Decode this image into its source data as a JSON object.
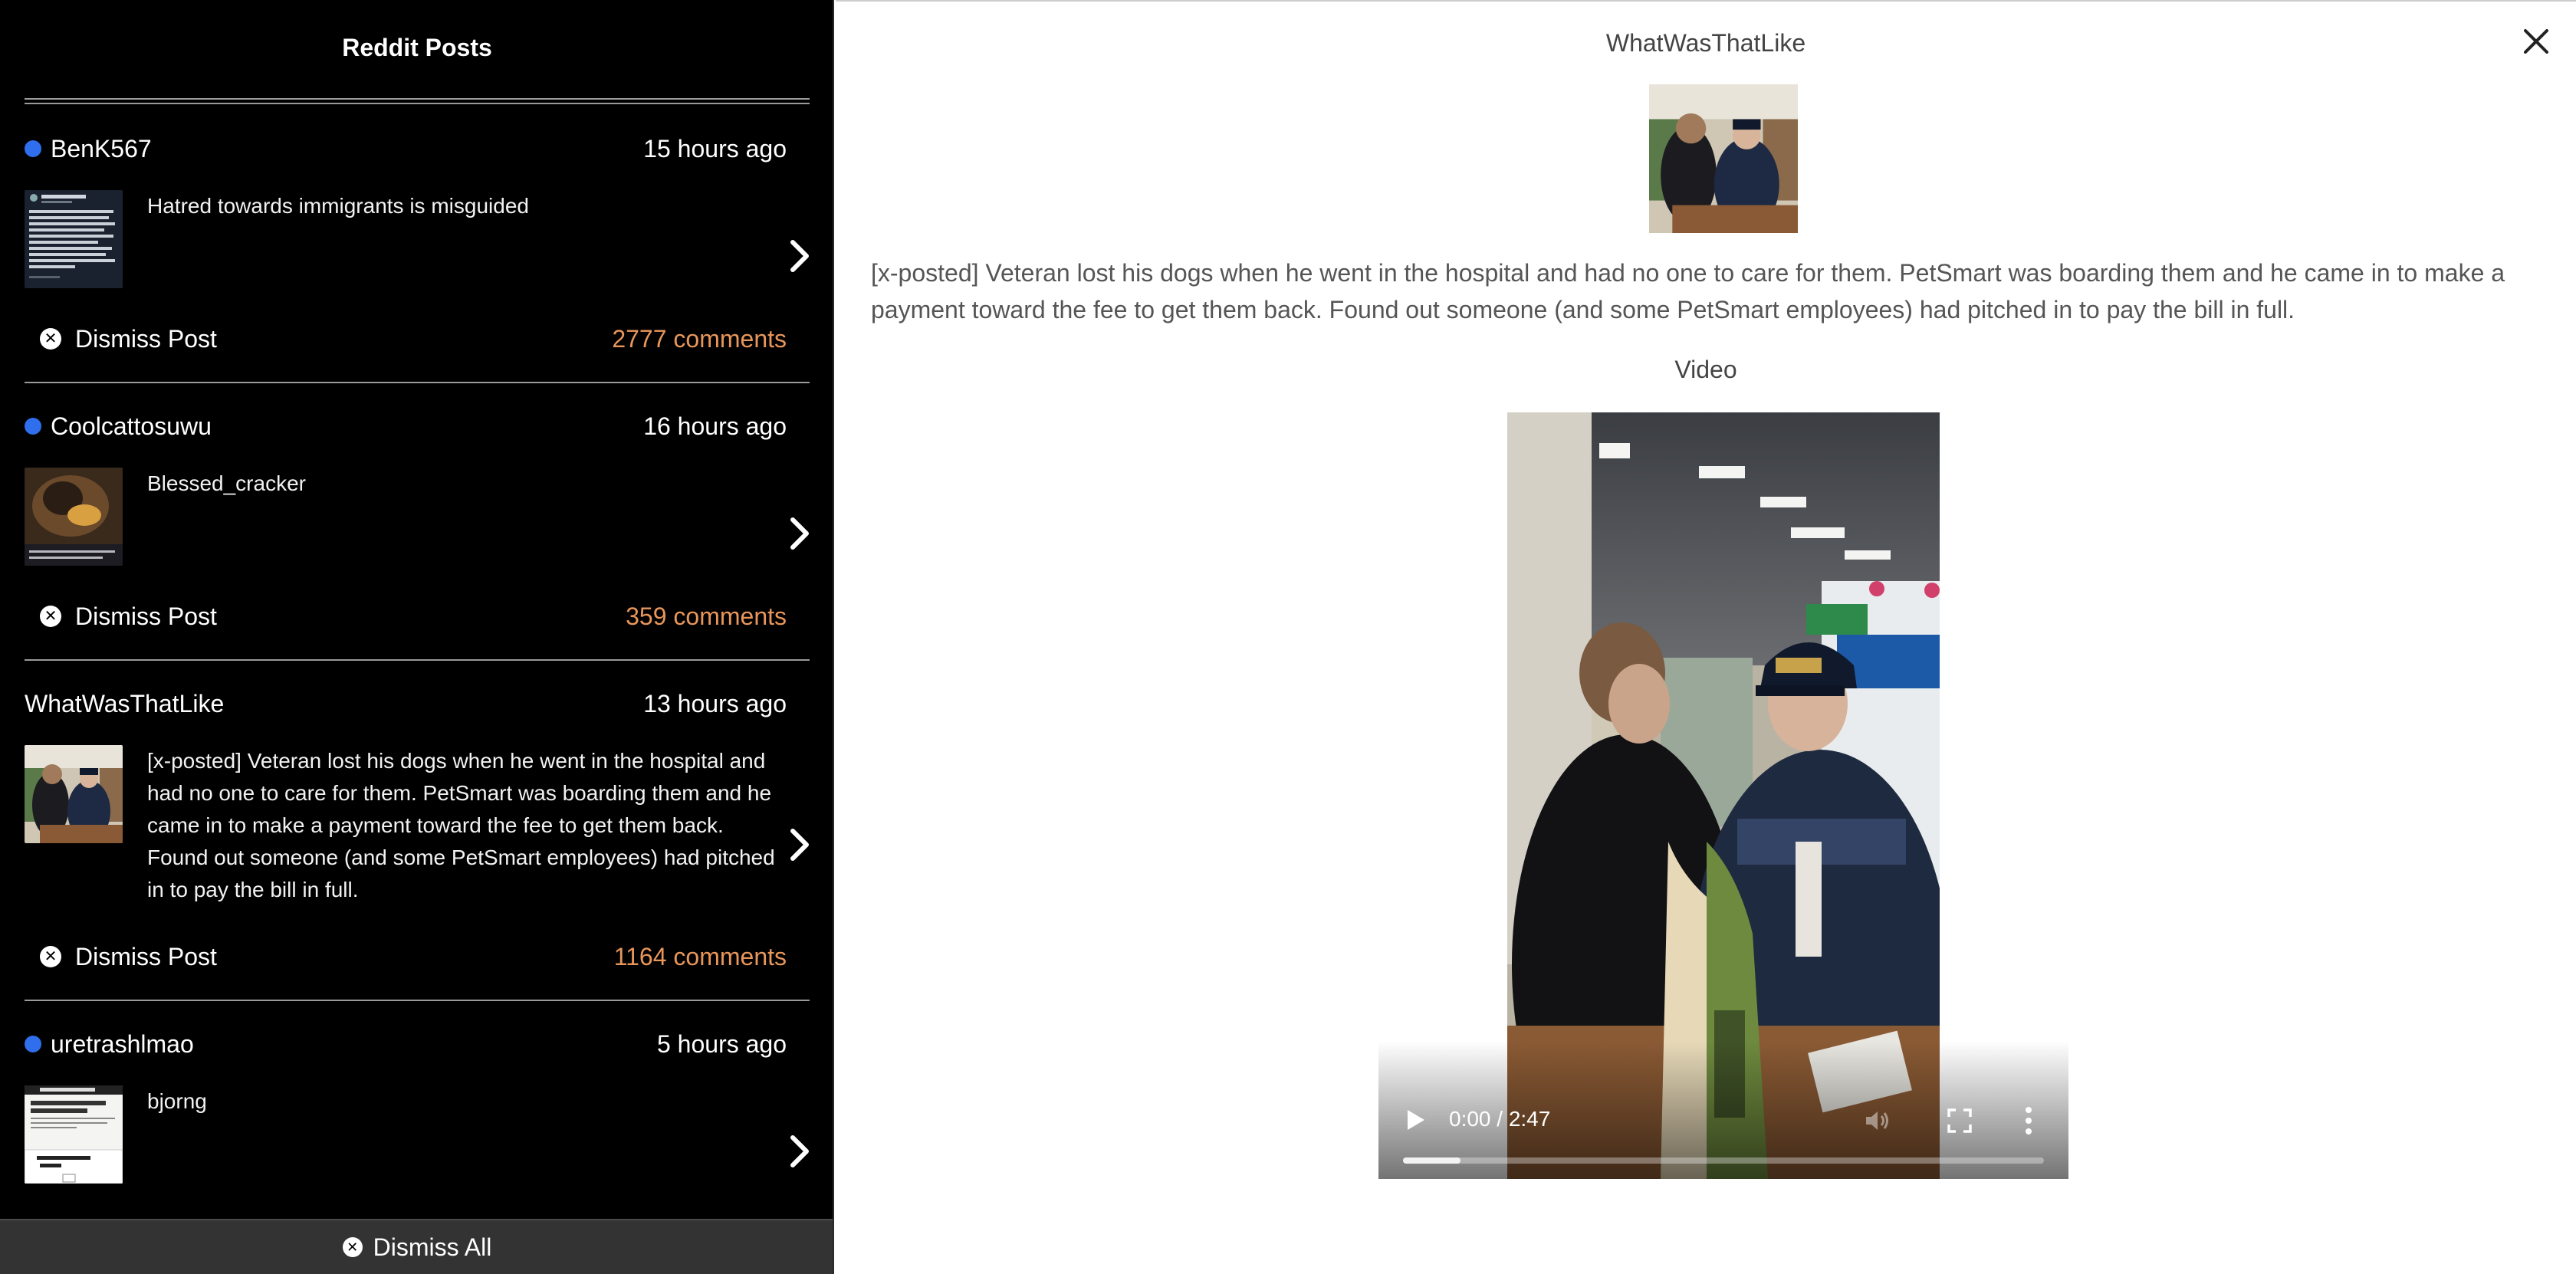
{
  "sidebar": {
    "title": "Reddit Posts",
    "dismiss_all_label": "Dismiss All",
    "posts": [
      {
        "user": "BenK567",
        "unread": true,
        "time": "15 hours ago",
        "text": "Hatred towards immigrants is misguided",
        "dismiss": "Dismiss Post",
        "comments": "2777 comments"
      },
      {
        "user": "Coolcattosuwu",
        "unread": true,
        "time": "16 hours ago",
        "text": "Blessed_cracker",
        "dismiss": "Dismiss Post",
        "comments": "359 comments"
      },
      {
        "user": "WhatWasThatLike",
        "unread": false,
        "time": "13 hours ago",
        "text": "[x-posted] Veteran lost his dogs when he went in the hospital and had no one to care for them. PetSmart was boarding them and he came in to make a payment toward the fee to get them back. Found out someone (and some PetSmart employees) had pitched in to pay the bill in full.",
        "dismiss": "Dismiss Post",
        "comments": "1164 comments"
      },
      {
        "user": "uretrashlmao",
        "unread": true,
        "time": "5 hours ago",
        "text": "bjorng"
      }
    ]
  },
  "detail": {
    "title": "WhatWasThatLike",
    "body": "[x-posted] Veteran lost his dogs when he went in the hospital and had no one to care for them. PetSmart was boarding them and he came in to make a payment toward the fee to get them back. Found out someone (and some PetSmart employees) had pitched in to pay the bill in full.",
    "media_label": "Video",
    "video": {
      "time": "0:00 / 2:47",
      "buffered_fraction": 0.09
    }
  },
  "colors": {
    "unread_dot": "#2f6fed",
    "comments": "#e8965a",
    "sidebar_bg": "#000000"
  },
  "icons": [
    "close-icon",
    "chevron-right-icon",
    "dismiss-x-icon",
    "play-icon",
    "volume-icon",
    "fullscreen-icon",
    "more-vert-icon"
  ]
}
